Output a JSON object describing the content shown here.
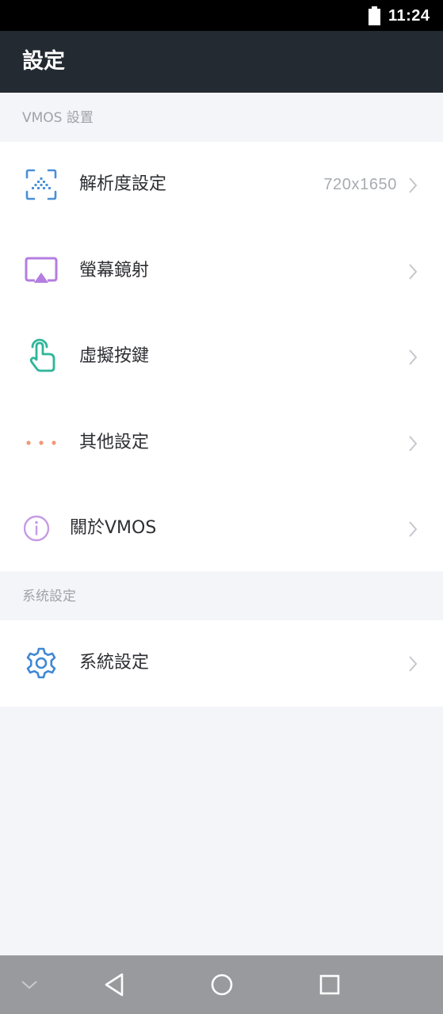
{
  "status_bar": {
    "time": "11:24",
    "icons": [
      "battery-icon"
    ]
  },
  "app_bar": {
    "title": "設定"
  },
  "sections": [
    {
      "header": "VMOS 設置",
      "items": [
        {
          "icon": "resolution-icon",
          "label": "解析度設定",
          "value": "720x1650",
          "icon_color": "#4a90d9"
        },
        {
          "icon": "screen-mirror-icon",
          "label": "螢幕鏡射",
          "value": "",
          "icon_color": "#b47ee0"
        },
        {
          "icon": "touch-finger-icon",
          "label": "虛擬按鍵",
          "value": "",
          "icon_color": "#2fb59a"
        },
        {
          "icon": "more-dots-icon",
          "label": "其他設定",
          "value": "",
          "icon_color": "#f0997a"
        },
        {
          "icon": "info-icon",
          "label": "關於VMOS",
          "value": "",
          "icon_color": "#c59be6"
        }
      ]
    },
    {
      "header": "系统設定",
      "items": [
        {
          "icon": "gear-icon",
          "label": "系統設定",
          "value": "",
          "icon_color": "#3f87d6"
        }
      ]
    }
  ],
  "nav_bar": {
    "icons": [
      "chevron-down-icon",
      "back-icon",
      "home-icon",
      "recents-icon"
    ]
  },
  "colors": {
    "app_bar": "#232a31",
    "status_bar": "#000000",
    "background": "#f4f5f9",
    "nav_bar": "#989a9d"
  }
}
